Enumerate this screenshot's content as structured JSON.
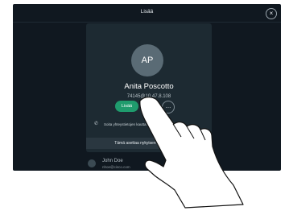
{
  "header": {
    "title": "Lisää",
    "close_icon": "close-icon"
  },
  "contact_card": {
    "initials": "AP",
    "name": "Anita Poscotto",
    "address": "74145@10.47.8.108",
    "add_label": "Lisää",
    "favorite_icon": "star-icon",
    "more_icon": "more-icon",
    "info_text": "Soita yhteystietojen kautta…",
    "subbar_text": "Tämä asettaa nykyisen puhelun pitoon"
  },
  "background_list": {
    "name": "John Doe",
    "email": "nhoe@cisco.com"
  },
  "colors": {
    "screen": "#101820",
    "card": "#1d2a32",
    "accent_green": "#1f9b6d"
  }
}
